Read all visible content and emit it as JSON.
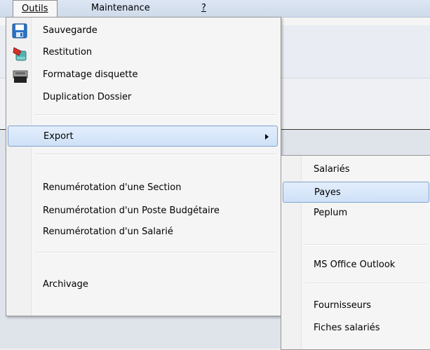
{
  "menubar": {
    "items": [
      {
        "label": "Outils",
        "mnemonic": "O"
      },
      {
        "label": "Maintenance",
        "mnemonic": "M"
      },
      {
        "label": "?"
      }
    ]
  },
  "menu": {
    "items": [
      {
        "label": "Sauvegarde",
        "icon": "floppy-disk-icon"
      },
      {
        "label": "Restitution",
        "icon": "restore-jar-icon"
      },
      {
        "label": "Formatage disquette",
        "icon": "disk-drive-icon"
      },
      {
        "label": "Duplication Dossier"
      },
      {
        "label": "Export",
        "has_submenu": true
      },
      {
        "label": "Renumérotation d'une Section"
      },
      {
        "label": "Renumérotation d'un Poste Budgétaire"
      },
      {
        "label": "Renumérotation d'un Salarié"
      },
      {
        "label": "Archivage"
      }
    ]
  },
  "submenu": {
    "items": [
      {
        "label": "Salariés"
      },
      {
        "label": "Payes"
      },
      {
        "label": "Peplum"
      },
      {
        "label": "MS Office Outlook"
      },
      {
        "label": "Fournisseurs"
      },
      {
        "label": "Fiches salariés"
      }
    ]
  },
  "colors": {
    "highlight_border": "#7da2ce",
    "highlight_fill": "#cfe1f7",
    "menubar": "#cfdaea"
  }
}
